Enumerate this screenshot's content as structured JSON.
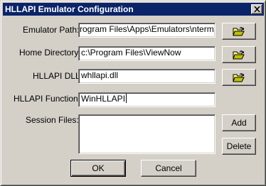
{
  "window": {
    "title": "HLLAPI Emulator Configuration"
  },
  "fields": {
    "emulator_path": {
      "label": "Emulator Path:",
      "value": "rogram Files\\Apps\\Emulators\\nterm.exe"
    },
    "home_directory": {
      "label": "Home Directory:",
      "value": "c:\\Program Files\\ViewNow"
    },
    "hllapi_dll": {
      "label": "HLLAPI DLL:",
      "value": "whllapi.dll"
    },
    "hllapi_function": {
      "label": "HLLAPI Function:",
      "value": "WinHLLAPI"
    },
    "session_files": {
      "label": "Session Files:"
    }
  },
  "buttons": {
    "add": "Add",
    "delete": "Delete",
    "ok": "OK",
    "cancel": "Cancel"
  },
  "icons": {
    "browse": "open-folder-icon",
    "close": "close-icon"
  }
}
